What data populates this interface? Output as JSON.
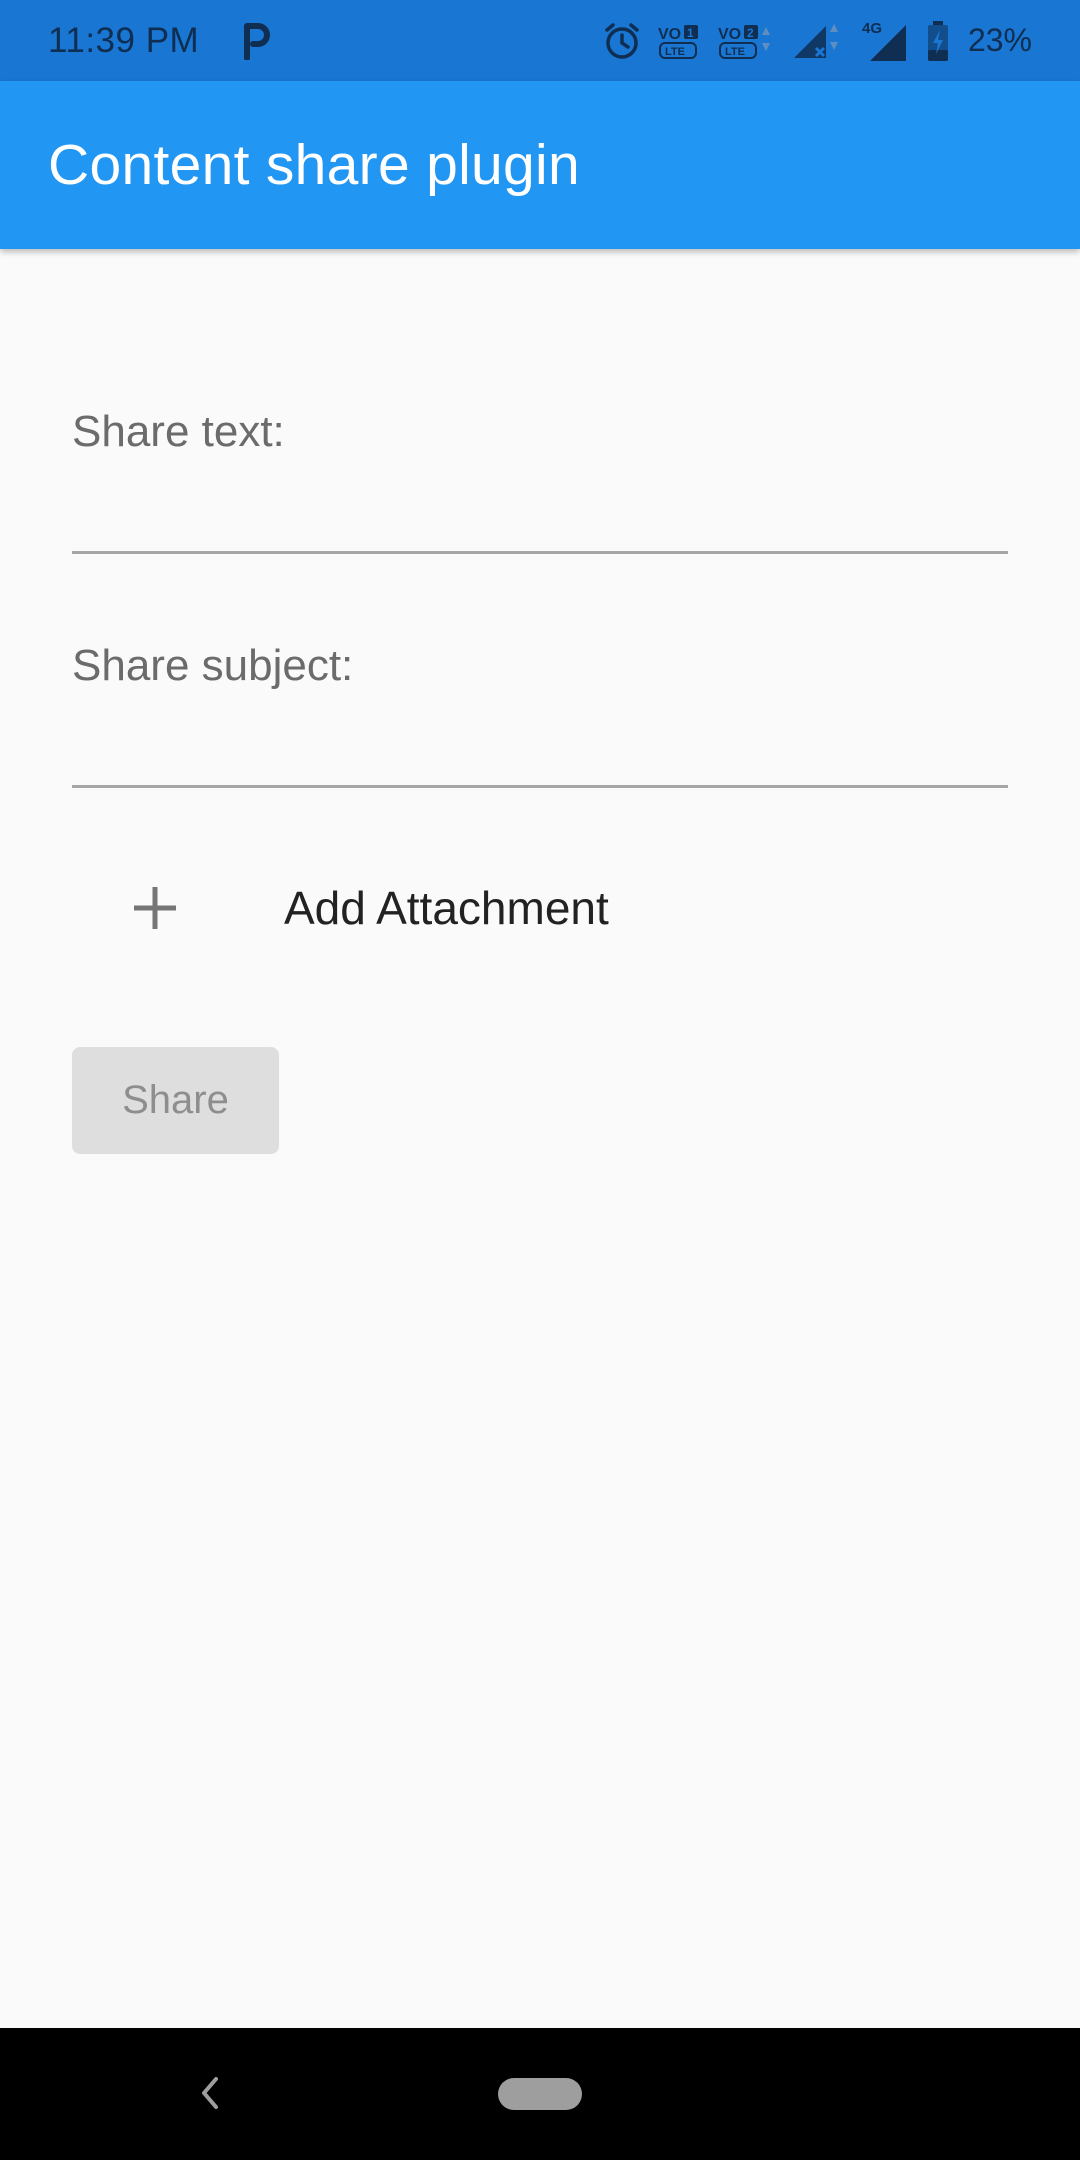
{
  "status_bar": {
    "time": "11:39 PM",
    "battery": "23%",
    "network": "4G",
    "icons": [
      "parking-icon",
      "alarm-icon",
      "volte1-icon",
      "volte2-icon",
      "signal-icon",
      "signal-4g-icon",
      "battery-charging-icon"
    ]
  },
  "app_bar": {
    "title": "Content share plugin",
    "color": "#2196f3"
  },
  "form": {
    "share_text_label": "Share text:",
    "share_text_value": "",
    "share_subject_label": "Share subject:",
    "share_subject_value": "",
    "add_attachment_label": "Add Attachment",
    "add_attachment_icon": "plus-icon",
    "share_button_label": "Share"
  },
  "nav_bar": {
    "icons": [
      "back-icon",
      "home-pill-icon"
    ]
  }
}
